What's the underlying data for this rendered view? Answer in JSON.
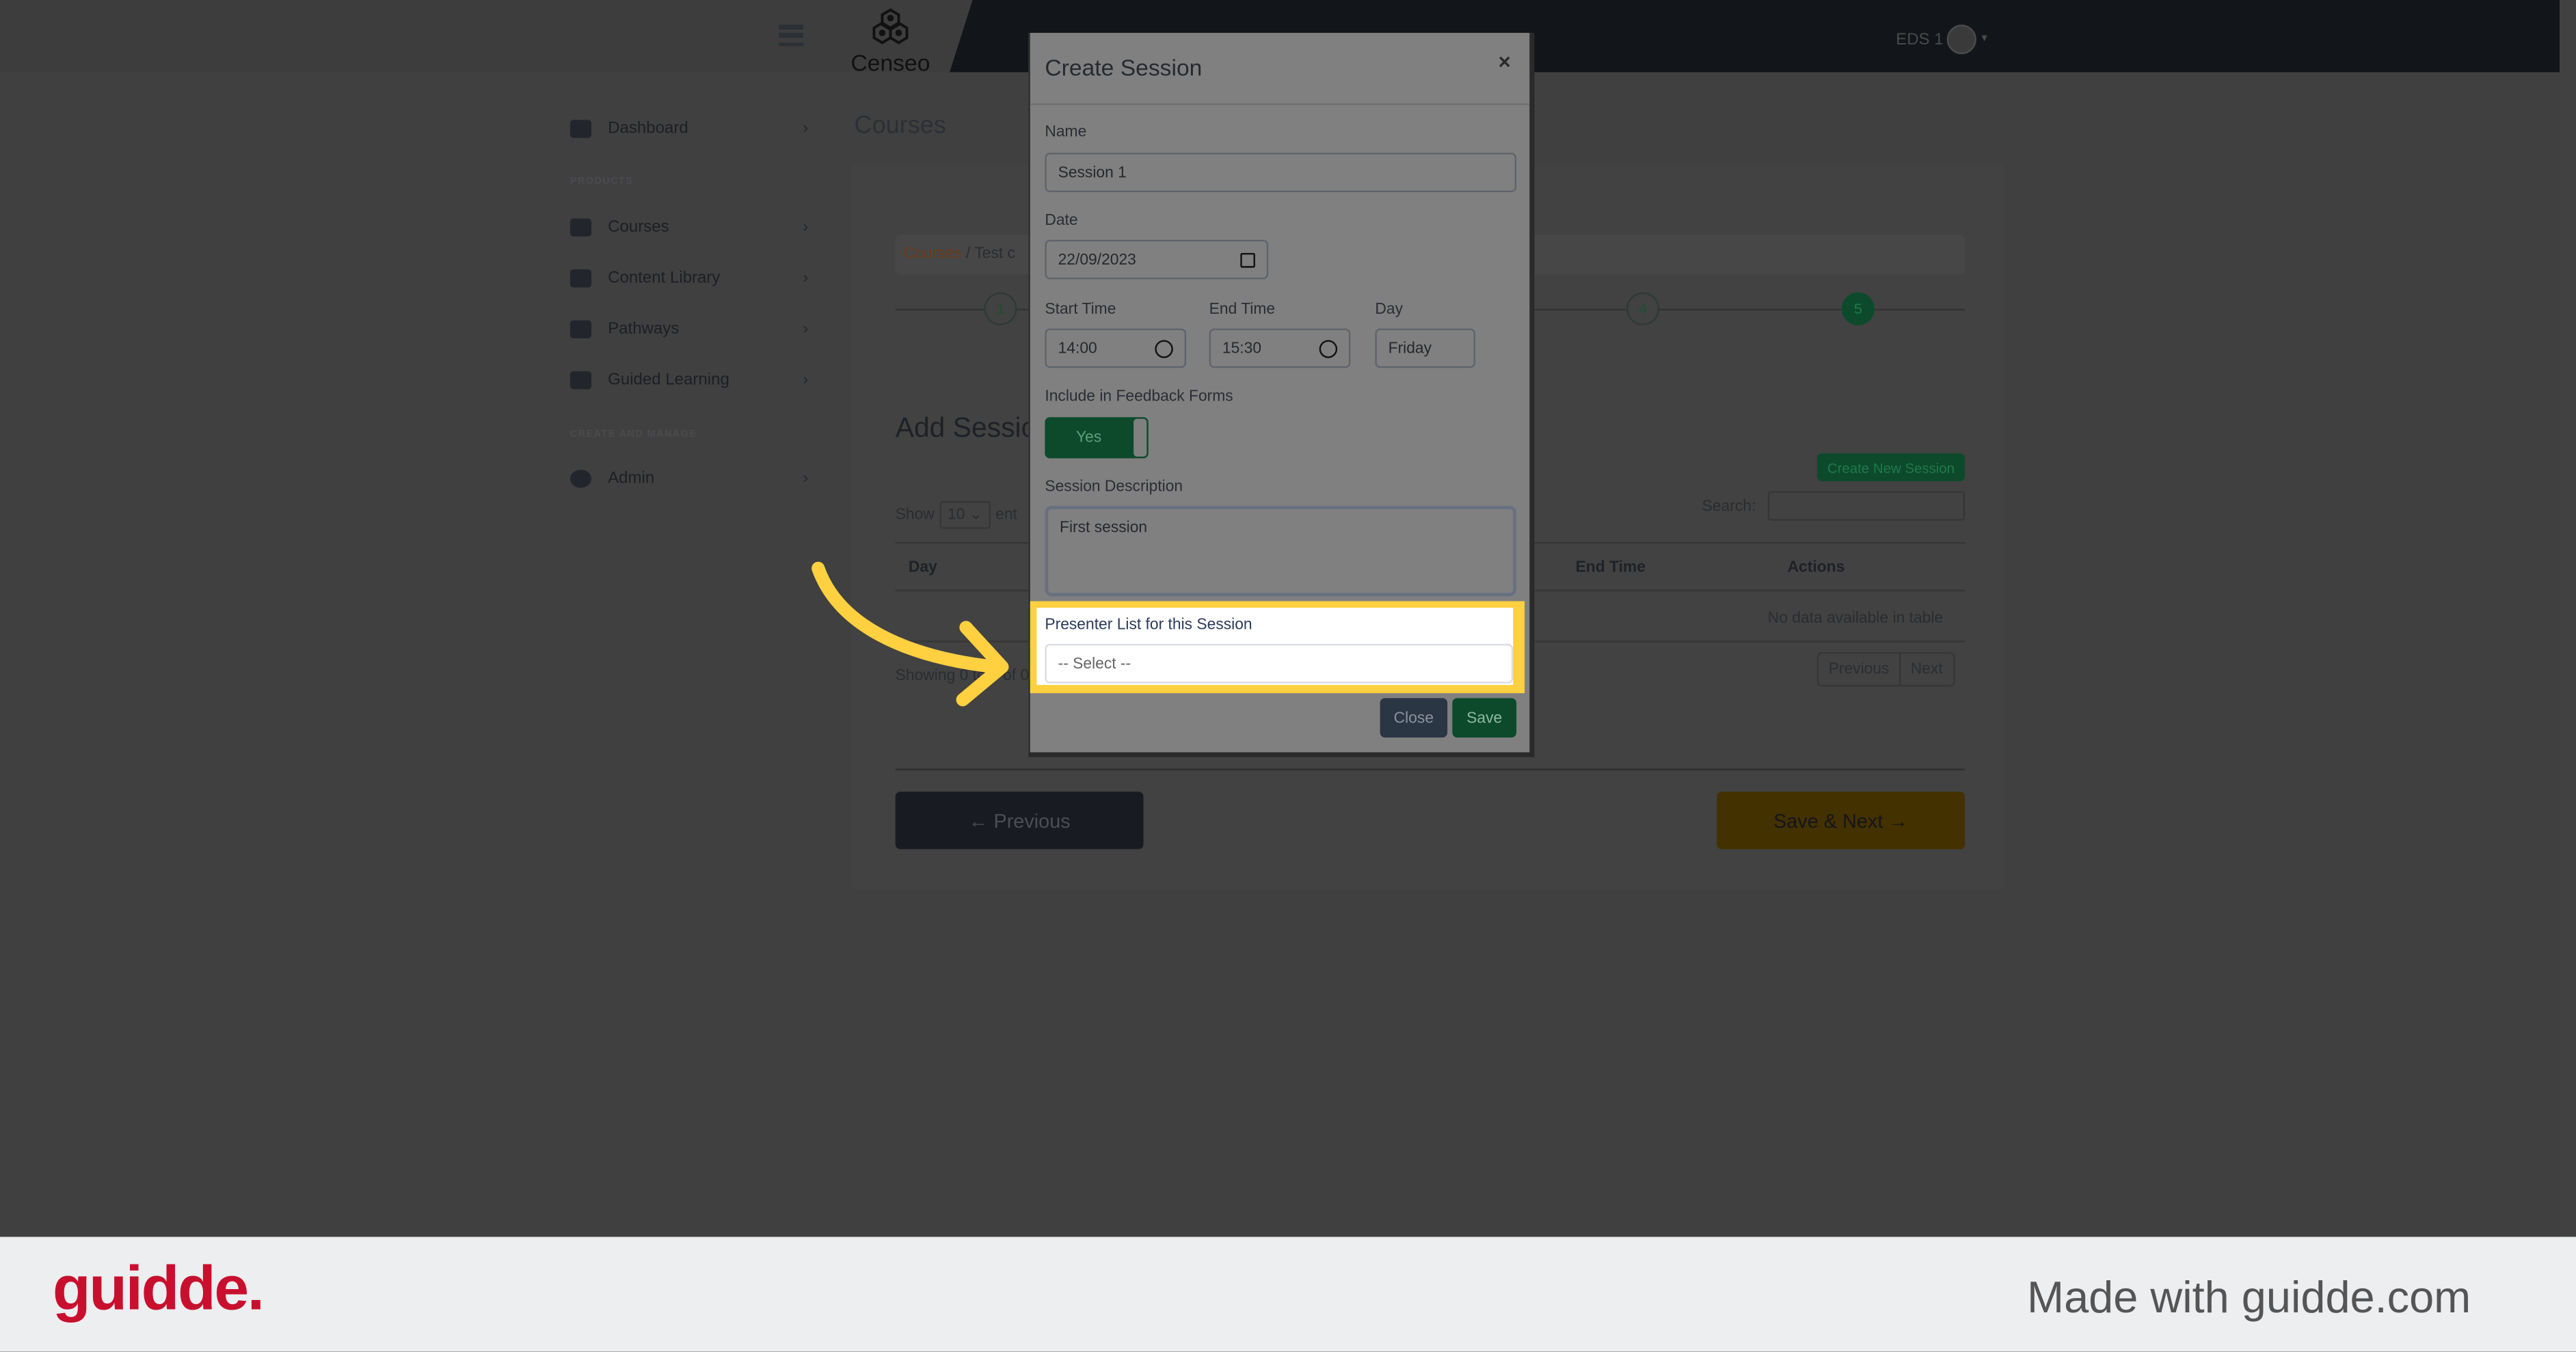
{
  "header": {
    "logo_text": "Censeo",
    "user_label": "EDS 1"
  },
  "sidebar": {
    "items": [
      {
        "label": "Dashboard",
        "icon": "gauge-icon"
      },
      {
        "label": "Courses",
        "icon": "chalkboard-user-icon"
      },
      {
        "label": "Content Library",
        "icon": "book-icon"
      },
      {
        "label": "Pathways",
        "icon": "award-icon"
      },
      {
        "label": "Guided Learning",
        "icon": "clipboard-list-icon"
      },
      {
        "label": "Admin",
        "icon": "gear-icon"
      }
    ],
    "sections": [
      "PRODUCTS",
      "CREATE AND MANAGE"
    ]
  },
  "main": {
    "page_title": "Courses",
    "breadcrumb": [
      "Courses",
      "Test c"
    ],
    "steps": [
      "1",
      "4",
      "5"
    ],
    "section_title": "Add Sessio",
    "create_button": "Create New Session",
    "show_label": "Show",
    "entries_value": "10",
    "entries_suffix": "ent",
    "search_label": "Search:",
    "table": {
      "columns": [
        "Day",
        "End Time",
        "Actions"
      ],
      "empty_text": "No data available in table"
    },
    "showing_text": "Showing 0 to 0 of 0",
    "pagination": {
      "previous": "Previous",
      "next": "Next"
    },
    "previous_button": "Previous",
    "save_next_button": "Save & Next"
  },
  "modal": {
    "title": "Create Session",
    "close_symbol": "×",
    "name_label": "Name",
    "name_value": "Session 1",
    "date_label": "Date",
    "date_value": "22/09/2023",
    "start_label": "Start Time",
    "start_value": "14:00",
    "end_label": "End Time",
    "end_value": "15:30",
    "day_label": "Day",
    "day_value": "Friday",
    "feedback_label": "Include in Feedback Forms",
    "feedback_toggle": "Yes",
    "description_label": "Session Description",
    "description_value": "First session",
    "presenter_label": "Presenter List for this Session",
    "presenter_placeholder": "-- Select --",
    "close_button": "Close",
    "save_button": "Save"
  },
  "footer": {
    "brand": "guidde.",
    "tagline": "Made with guidde.com"
  },
  "colors": {
    "highlight": "#ffd03f",
    "brand_red": "#c8102e",
    "green": "#0d4a2c"
  }
}
